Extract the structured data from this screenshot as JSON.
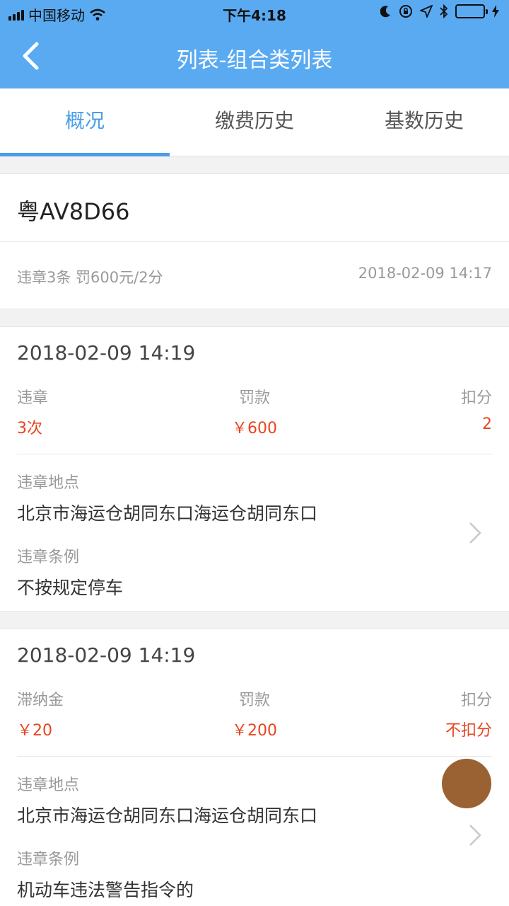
{
  "status_bar": {
    "carrier": "中国移动",
    "time": "下午4:18"
  },
  "nav": {
    "title": "列表-组合类列表"
  },
  "tabs": [
    {
      "label": "概况",
      "active": true
    },
    {
      "label": "缴费历史",
      "active": false
    },
    {
      "label": "基数历史",
      "active": false
    }
  ],
  "vehicle": {
    "plate": "粤AV8D66",
    "summary": "违章3条 罚600元/2分",
    "updated": "2018-02-09 14:17"
  },
  "records": [
    {
      "date": "2018-02-09 14:19",
      "stats": [
        {
          "label": "违章",
          "value": "3次"
        },
        {
          "label": "罚款",
          "value": "￥600"
        },
        {
          "label": "扣分",
          "value": "2"
        }
      ],
      "location_label": "违章地点",
      "location": "北京市海运仓胡同东口海运仓胡同东口",
      "rule_label": "违章条例",
      "rule": "不按规定停车"
    },
    {
      "date": "2018-02-09 14:19",
      "stats": [
        {
          "label": "滞纳金",
          "value": "￥20"
        },
        {
          "label": "罚款",
          "value": "￥200"
        },
        {
          "label": "扣分",
          "value": "不扣分"
        }
      ],
      "location_label": "违章地点",
      "location": "北京市海运仓胡同东口海运仓胡同东口",
      "rule_label": "违章条例",
      "rule": "机动车违法警告指令的"
    }
  ],
  "colors": {
    "header": "#5aaaf2",
    "tab_active": "#4a9ee8",
    "value_red": "#e8451f",
    "fab": "#9a6133"
  }
}
